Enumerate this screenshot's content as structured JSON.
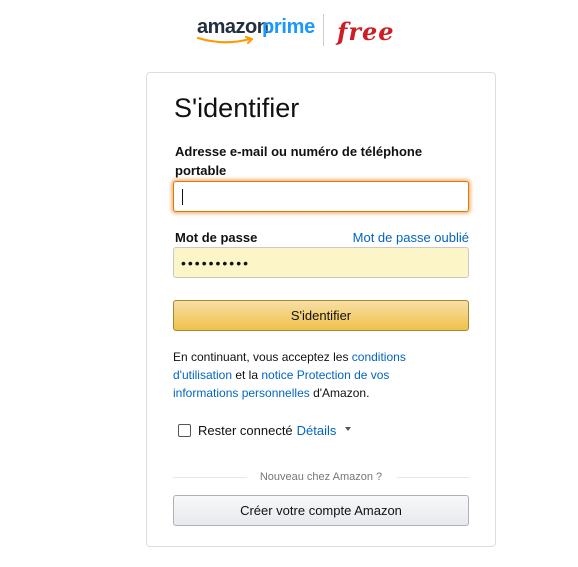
{
  "brand": {
    "amazon": "amazon",
    "prime": "prime",
    "partner": "free",
    "prime_color": "#1a98ff",
    "partner_color": "#cd1e25"
  },
  "form": {
    "title": "S'identifier",
    "email_label": "Adresse e-mail ou numéro de téléphone portable",
    "email_value": "",
    "password_label": "Mot de passe",
    "forgot_password_link": "Mot de passe oublié",
    "password_value": "••••••••••",
    "submit_label": "S'identifier",
    "accent_color": "#f0c14b"
  },
  "legal": {
    "prefix": "En continuant, vous acceptez les ",
    "terms_link": "conditions d'utilisation",
    "middle": " et la ",
    "privacy_link": "notice Protection de vos informations personnelles",
    "suffix": " d'Amazon."
  },
  "remember": {
    "label": "Rester connecté",
    "details_link": "Détails",
    "checked": false
  },
  "signup": {
    "divider_text": "Nouveau chez Amazon ?",
    "create_account_label": "Créer votre compte Amazon"
  }
}
